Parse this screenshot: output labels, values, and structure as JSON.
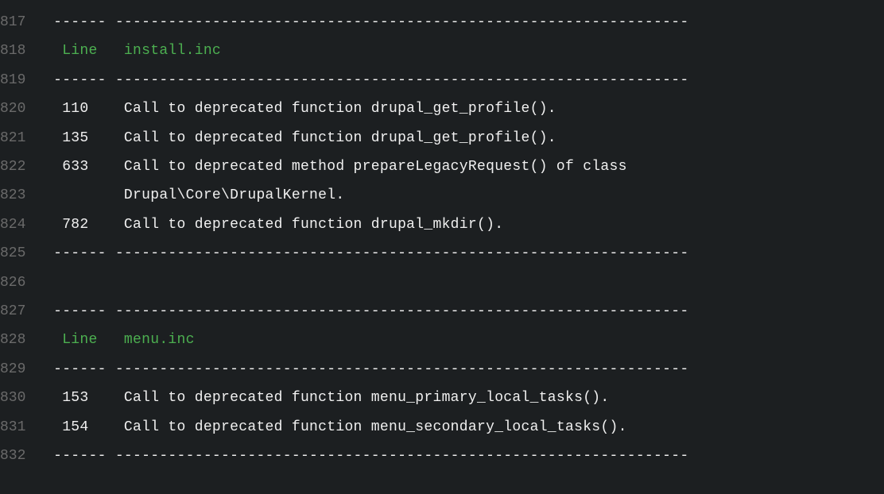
{
  "lines": [
    {
      "num": "817",
      "segments": [
        {
          "cls": "white",
          "text": " ------ ----------------------------------------------------------------- "
        }
      ]
    },
    {
      "num": "818",
      "segments": [
        {
          "cls": "green",
          "text": "  Line   install.inc                                                       "
        }
      ]
    },
    {
      "num": "819",
      "segments": [
        {
          "cls": "white",
          "text": " ------ ----------------------------------------------------------------- "
        }
      ]
    },
    {
      "num": "820",
      "segments": [
        {
          "cls": "white",
          "text": "  110    Call to deprecated function drupal_get_profile().                 "
        }
      ]
    },
    {
      "num": "821",
      "segments": [
        {
          "cls": "white",
          "text": "  135    Call to deprecated function drupal_get_profile().                 "
        }
      ]
    },
    {
      "num": "822",
      "segments": [
        {
          "cls": "white",
          "text": "  633    Call to deprecated method prepareLegacyRequest() of class         "
        }
      ]
    },
    {
      "num": "823",
      "segments": [
        {
          "cls": "white",
          "text": "         Drupal\\Core\\DrupalKernel.                                         "
        }
      ]
    },
    {
      "num": "824",
      "segments": [
        {
          "cls": "white",
          "text": "  782    Call to deprecated function drupal_mkdir().                       "
        }
      ]
    },
    {
      "num": "825",
      "segments": [
        {
          "cls": "white",
          "text": " ------ ----------------------------------------------------------------- "
        }
      ]
    },
    {
      "num": "826",
      "segments": [
        {
          "cls": "white",
          "text": ""
        }
      ]
    },
    {
      "num": "827",
      "segments": [
        {
          "cls": "white",
          "text": " ------ ----------------------------------------------------------------- "
        }
      ]
    },
    {
      "num": "828",
      "segments": [
        {
          "cls": "green",
          "text": "  Line   menu.inc                                                          "
        }
      ]
    },
    {
      "num": "829",
      "segments": [
        {
          "cls": "white",
          "text": " ------ ----------------------------------------------------------------- "
        }
      ]
    },
    {
      "num": "830",
      "segments": [
        {
          "cls": "white",
          "text": "  153    Call to deprecated function menu_primary_local_tasks().           "
        }
      ]
    },
    {
      "num": "831",
      "segments": [
        {
          "cls": "white",
          "text": "  154    Call to deprecated function menu_secondary_local_tasks().         "
        }
      ]
    },
    {
      "num": "832",
      "segments": [
        {
          "cls": "white",
          "text": " ------ ----------------------------------------------------------------- "
        }
      ]
    }
  ]
}
